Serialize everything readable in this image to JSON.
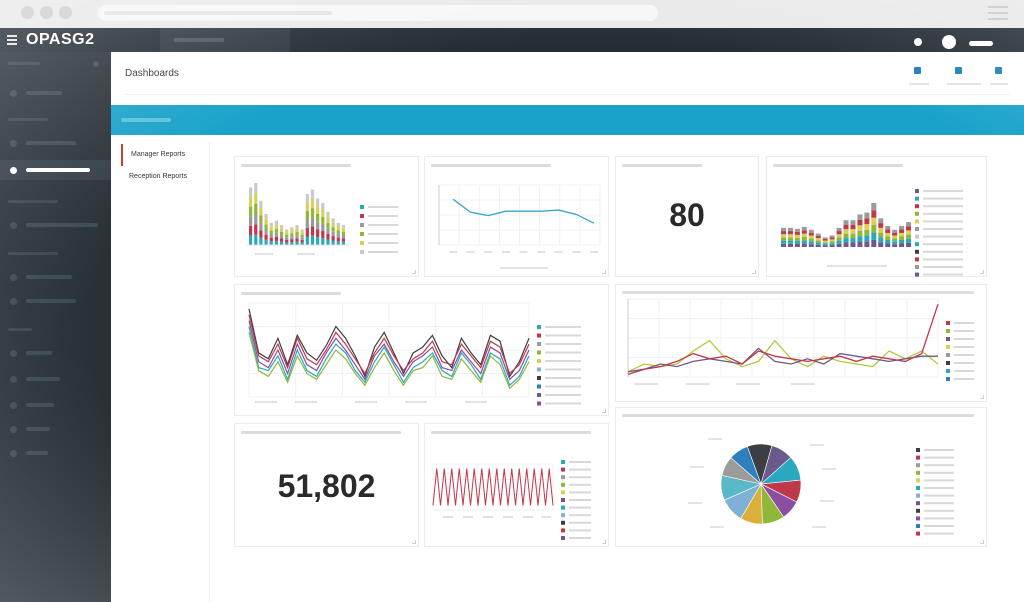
{
  "app": {
    "logo": "OPASG2"
  },
  "main": {
    "page_title": "Dashboards"
  },
  "report_nav": [
    {
      "label": "Manager Reports",
      "active": true
    },
    {
      "label": "Reception Reports",
      "active": false
    }
  ],
  "colors": {
    "topbar": "#232b33",
    "sidebar": "#283038",
    "banner": "#1aa2c9",
    "accent_blue": "#1e7fb8",
    "active_nav_marker": "#c0392b"
  },
  "icons": [
    "hamburger-icon",
    "user-avatar-icon",
    "notification-icon",
    "header-action-icon"
  ],
  "widgets": {
    "kpi_80": {
      "value": "80"
    },
    "kpi_51802": {
      "value": "51,802"
    }
  },
  "chart_data": [
    {
      "type": "bar",
      "stacked": true,
      "widget": "stacked-bar-small",
      "series_colors": [
        "#2aa8c0",
        "#c0394b",
        "#9b9b9b",
        "#8fb83a",
        "#d8d05a",
        "#c9c9c9"
      ],
      "totals": [
        52,
        56,
        40,
        28,
        20,
        22,
        18,
        14,
        16,
        18,
        14,
        46,
        50,
        42,
        38,
        30,
        24,
        20,
        18
      ]
    },
    {
      "type": "line",
      "widget": "single-line",
      "color": "#3aa6c8",
      "values": [
        42,
        30,
        27,
        31,
        31,
        31,
        32,
        28,
        20
      ],
      "ylim": [
        0,
        55
      ]
    },
    {
      "type": "bar",
      "stacked": true,
      "widget": "stacked-bar-medium",
      "series_colors": [
        "#6d5a8c",
        "#2aa8c0",
        "#8fb83a",
        "#d8d05a",
        "#c0394b",
        "#9b9b9b"
      ],
      "totals": [
        20,
        20,
        19,
        21,
        18,
        14,
        10,
        12,
        20,
        28,
        28,
        34,
        36,
        46,
        30,
        22,
        18,
        22,
        26
      ]
    },
    {
      "type": "line",
      "widget": "multi-line-wide",
      "series": [
        {
          "values": [
            60,
            30,
            26,
            40,
            22,
            42,
            30,
            25,
            35,
            48,
            40,
            28,
            14,
            34,
            44,
            30,
            16,
            30,
            34,
            42,
            28,
            20,
            40,
            30,
            22,
            42,
            38,
            14,
            24,
            40
          ]
        },
        {
          "values": [
            56,
            28,
            24,
            36,
            20,
            40,
            26,
            22,
            32,
            44,
            36,
            26,
            16,
            30,
            40,
            28,
            18,
            26,
            30,
            38,
            24,
            22,
            36,
            28,
            20,
            38,
            34,
            16,
            22,
            36
          ]
        },
        {
          "values": [
            52,
            24,
            20,
            32,
            16,
            36,
            22,
            18,
            30,
            40,
            32,
            22,
            12,
            28,
            36,
            24,
            14,
            24,
            28,
            34,
            20,
            18,
            32,
            24,
            16,
            34,
            30,
            12,
            18,
            32
          ]
        },
        {
          "values": [
            48,
            20,
            18,
            28,
            12,
            32,
            18,
            14,
            26,
            36,
            30,
            18,
            10,
            24,
            34,
            22,
            10,
            20,
            24,
            30,
            18,
            14,
            30,
            22,
            12,
            30,
            26,
            8,
            14,
            28
          ]
        },
        {
          "values": [
            44,
            18,
            14,
            24,
            10,
            28,
            16,
            12,
            22,
            32,
            26,
            16,
            8,
            20,
            30,
            18,
            8,
            18,
            20,
            28,
            14,
            12,
            26,
            18,
            10,
            28,
            22,
            6,
            12,
            24
          ]
        }
      ]
    },
    {
      "type": "line",
      "widget": "multi-line-right",
      "series": [
        {
          "values": [
            4,
            10,
            8,
            10,
            20,
            28,
            14,
            8,
            12,
            28,
            14,
            8,
            16,
            12,
            10,
            8,
            20,
            14,
            20,
            10
          ]
        },
        {
          "values": [
            4,
            6,
            10,
            8,
            12,
            14,
            12,
            10,
            22,
            12,
            10,
            14,
            10,
            18,
            16,
            14,
            12,
            14,
            16,
            16
          ]
        },
        {
          "values": [
            2,
            6,
            8,
            12,
            18,
            14,
            16,
            10,
            20,
            16,
            14,
            12,
            14,
            16,
            12,
            16,
            14,
            12,
            18,
            56
          ]
        }
      ]
    },
    {
      "type": "line",
      "widget": "zigzag",
      "color": "#c0394b",
      "values": [
        10,
        90,
        10,
        90,
        10,
        90,
        10,
        90,
        10,
        90,
        10,
        90,
        10,
        90,
        10,
        90,
        10,
        90,
        10,
        90,
        10,
        90,
        10,
        90,
        10,
        90,
        10,
        90,
        10,
        90,
        10,
        90,
        10
      ]
    },
    {
      "type": "pie",
      "widget": "pie",
      "slices": [
        {
          "value": 10,
          "color": "#3b3f43"
        },
        {
          "value": 9,
          "color": "#6d5a8c"
        },
        {
          "value": 10,
          "color": "#2aa8c0"
        },
        {
          "value": 9,
          "color": "#c0394b"
        },
        {
          "value": 8,
          "color": "#8a4fa0"
        },
        {
          "value": 9,
          "color": "#8fb83a"
        },
        {
          "value": 9,
          "color": "#d8b03a"
        },
        {
          "value": 10,
          "color": "#7fb0d8"
        },
        {
          "value": 10,
          "color": "#5bb8c8"
        },
        {
          "value": 8,
          "color": "#9b9b9b"
        },
        {
          "value": 8,
          "color": "#2f7fbf"
        }
      ]
    }
  ]
}
